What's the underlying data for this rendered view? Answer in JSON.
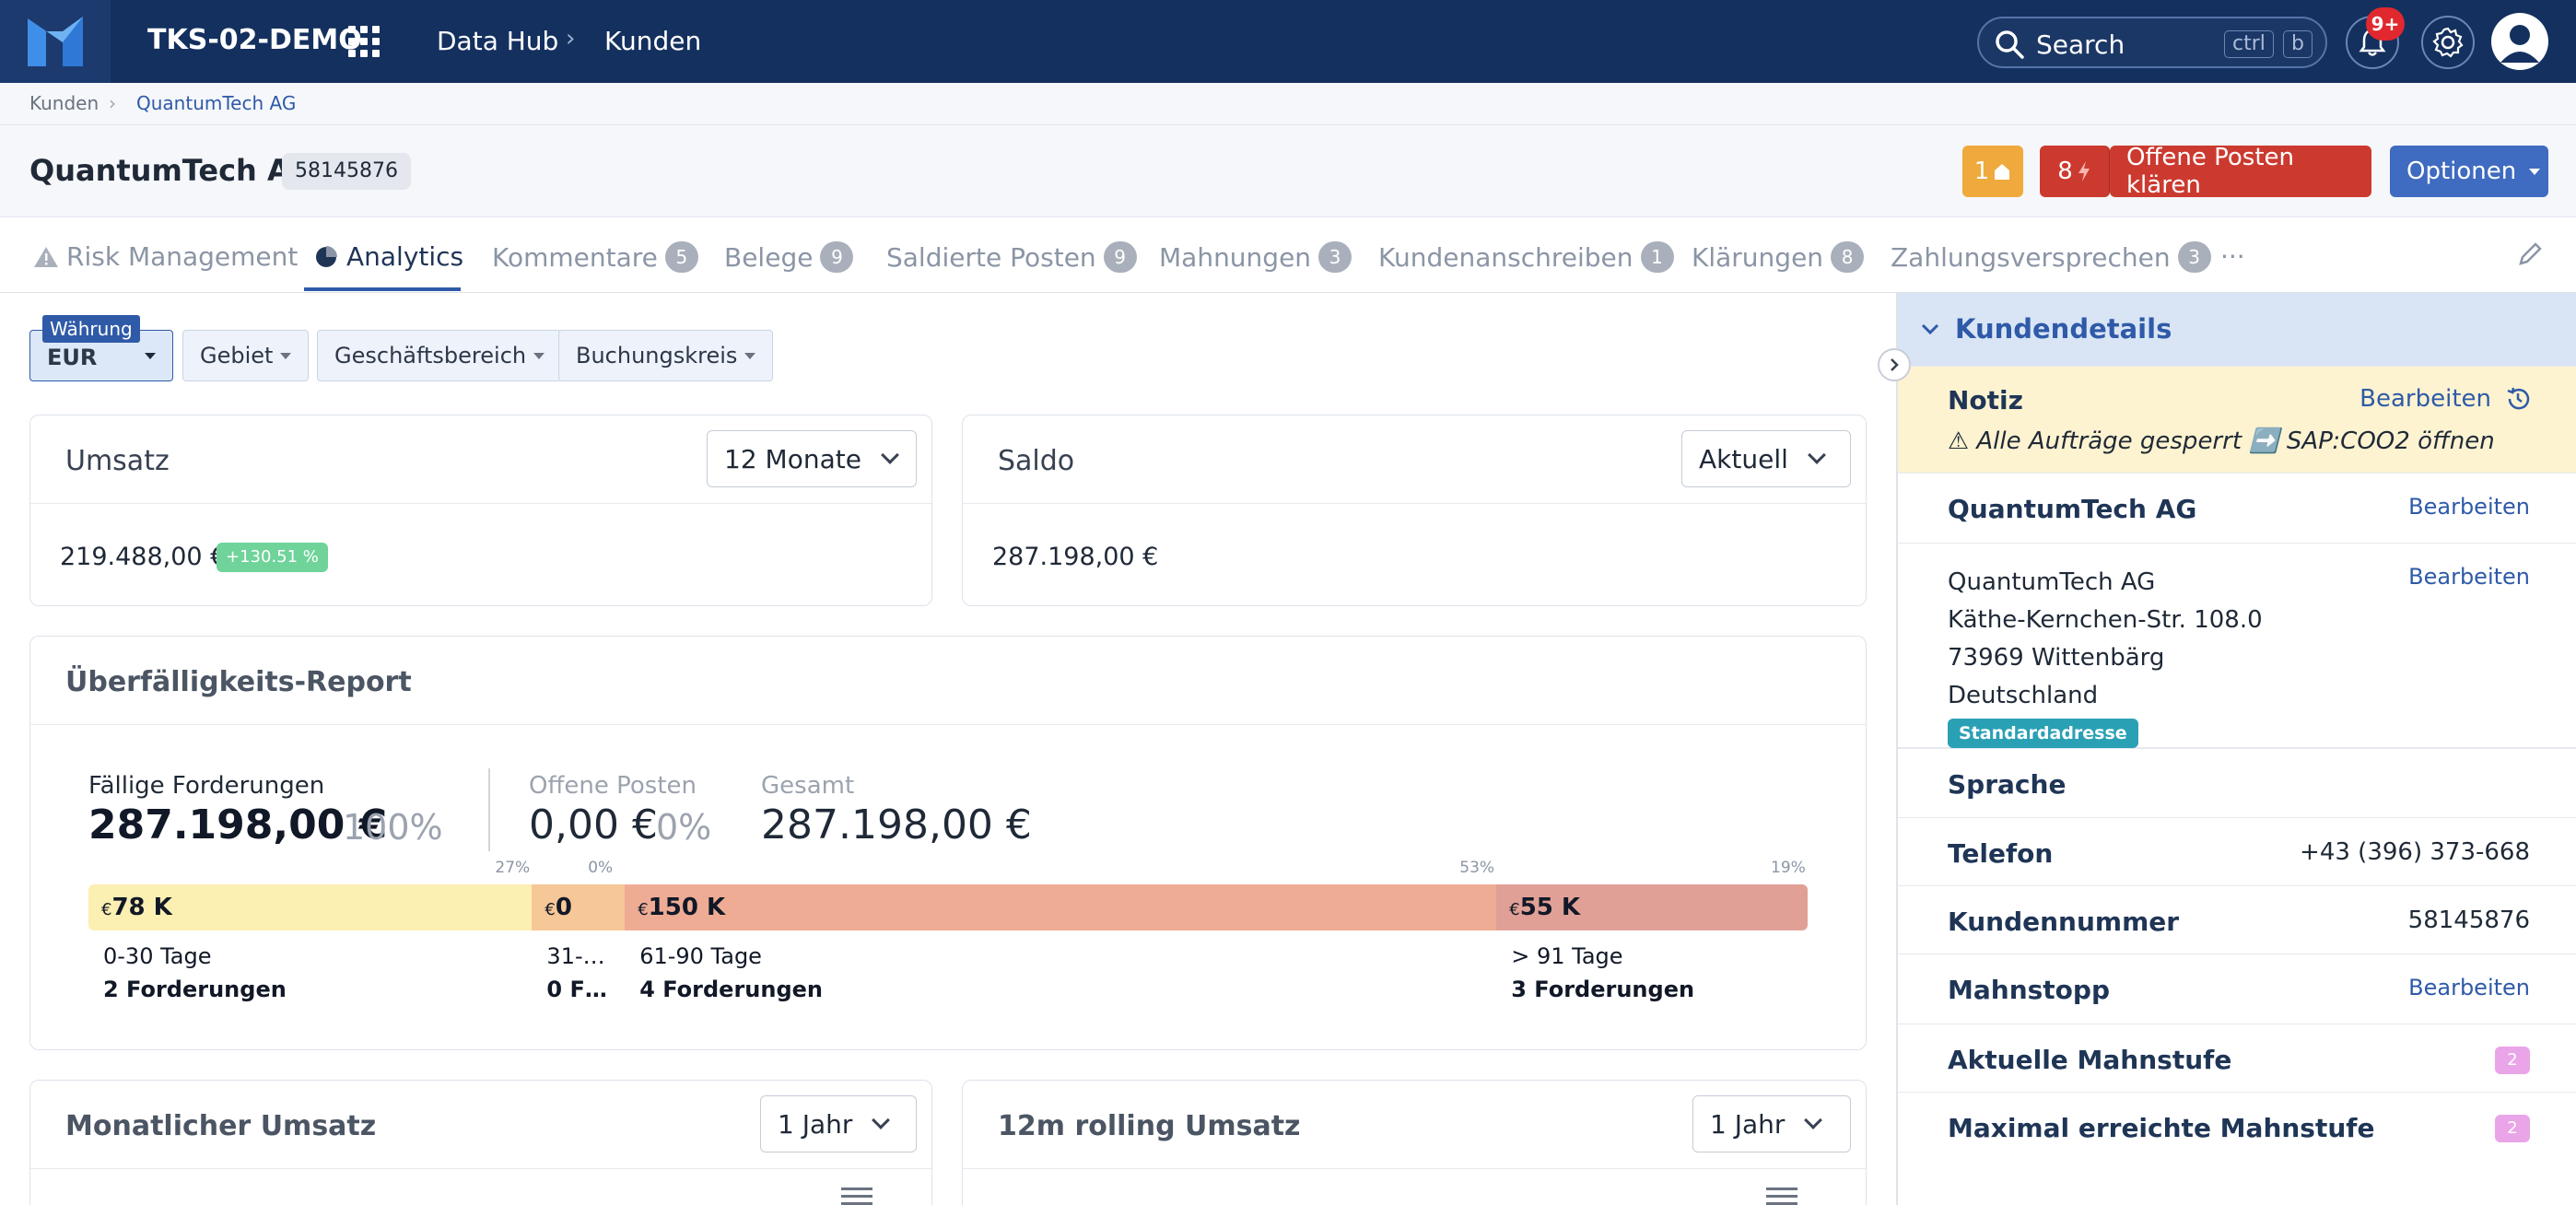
{
  "topbar": {
    "tenant": "TKS-02-DEMO",
    "crumb1": "Data Hub",
    "crumb2": "Kunden",
    "search_label": "Search",
    "kbd1": "ctrl",
    "kbd2": "b",
    "notif_count": "9+"
  },
  "breadcrumb": {
    "item1": "Kunden",
    "item2": "QuantumTech AG"
  },
  "header": {
    "title": "QuantumTech AG",
    "id": "58145876",
    "badge1": "1",
    "badge2": "8",
    "action": "Offene Posten klären",
    "options": "Optionen"
  },
  "tabs": [
    {
      "label": "Risk Management"
    },
    {
      "label": "Analytics"
    },
    {
      "label": "Kommentare",
      "count": "5"
    },
    {
      "label": "Belege",
      "count": "9"
    },
    {
      "label": "Saldierte Posten",
      "count": "9"
    },
    {
      "label": "Mahnungen",
      "count": "3"
    },
    {
      "label": "Kundenanschreiben",
      "count": "1"
    },
    {
      "label": "Klärungen",
      "count": "8"
    },
    {
      "label": "Zahlungsversprechen",
      "count": "3"
    },
    {
      "label": "···"
    }
  ],
  "filters": {
    "currency_tag": "Währung",
    "currency": "EUR",
    "f1": "Gebiet",
    "f2": "Geschäftsbereich",
    "f3": "Buchungskreis"
  },
  "umsatz": {
    "title": "Umsatz",
    "period": "12 Monate",
    "value": "219.488,00 €",
    "change": "+130.51 %"
  },
  "saldo": {
    "title": "Saldo",
    "period": "Aktuell",
    "value": "287.198,00 €"
  },
  "report": {
    "title": "Überfälligkeits-Report",
    "due_label": "Fällige Forderungen",
    "due_value": "287.198,00 €",
    "due_pct": "100%",
    "open_label": "Offene Posten",
    "open_value": "0,00 €",
    "open_pct": "0%",
    "total_label": "Gesamt",
    "total_value": "287.198,00 €",
    "buckets": [
      {
        "pct": "27%",
        "amount": "78 K",
        "range": "0-30 Tage",
        "count": "2 Forderungen",
        "share": 25.8,
        "color": "#fbefb1"
      },
      {
        "pct": "0%",
        "amount": "0",
        "range": "31-…",
        "count": "0 F…",
        "share": 5.4,
        "color": "#f6c797"
      },
      {
        "pct": "53%",
        "amount": "150 K",
        "range": "61-90 Tage",
        "count": "4 Forderungen",
        "share": 50.7,
        "color": "#eeac94"
      },
      {
        "pct": "19%",
        "amount": "55 K",
        "range": "> 91 Tage",
        "count": "3 Forderungen",
        "share": 18.1,
        "color": "#e1a096"
      }
    ],
    "currency_symbol": "€"
  },
  "monthly": {
    "title": "Monatlicher Umsatz",
    "period": "1 Jahr"
  },
  "rolling": {
    "title": "12m rolling Umsatz",
    "period": "1 Jahr"
  },
  "side": {
    "title": "Kundendetails",
    "note_label": "Notiz",
    "note_edit": "Bearbeiten",
    "note_text": "⚠ Alle Aufträge gesperrt ➡️ SAP:COO2 öffnen",
    "name": "QuantumTech AG",
    "edit": "Bearbeiten",
    "address": [
      "QuantumTech AG",
      "Käthe-Kernchen-Str. 108.0",
      "73969 Wittenbärg",
      "Deutschland"
    ],
    "address_tag": "Standardadresse",
    "sprache": "Sprache",
    "telefon_label": "Telefon",
    "telefon": "+43 (396) 373-668",
    "kundennummer_label": "Kundennummer",
    "kundennummer": "58145876",
    "mahnstopp": "Mahnstopp",
    "mahnstufe_label": "Aktuelle Mahnstufe",
    "mahnstufe": "2",
    "max_mahnstufe_label": "Maximal erreichte Mahnstufe",
    "max_mahnstufe": "2"
  }
}
